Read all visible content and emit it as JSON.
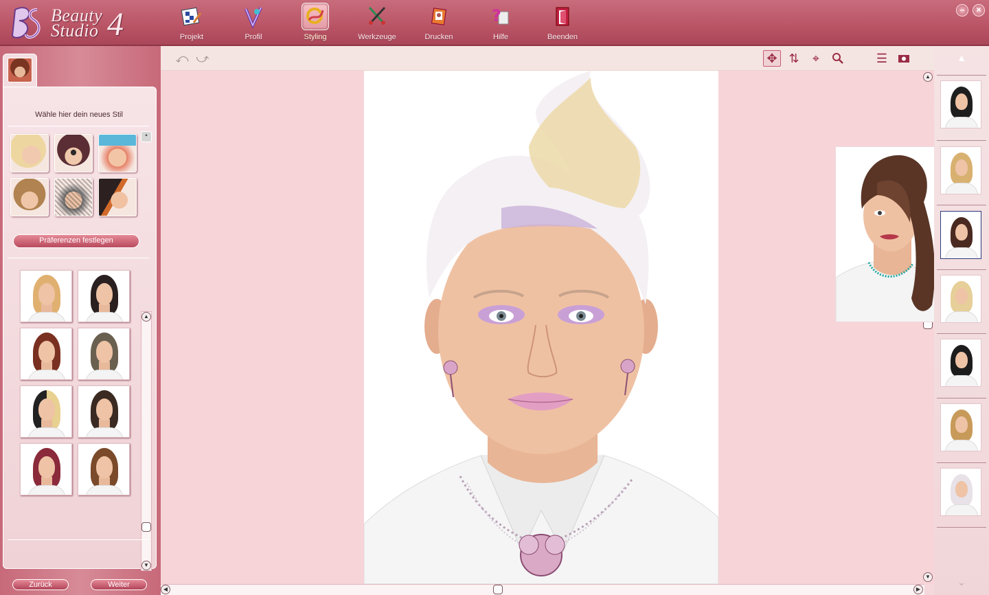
{
  "app": {
    "logo_line1": "Beauty",
    "logo_line2": "Studio",
    "logo_version": "4"
  },
  "nav": [
    {
      "label": "Projekt",
      "icon": "project-icon"
    },
    {
      "label": "Profil",
      "icon": "profile-icon"
    },
    {
      "label": "Styling",
      "icon": "styling-icon",
      "active": true
    },
    {
      "label": "Werkzeuge",
      "icon": "tools-icon"
    },
    {
      "label": "Drucken",
      "icon": "print-icon"
    },
    {
      "label": "Hilfe",
      "icon": "help-icon"
    },
    {
      "label": "Beenden",
      "icon": "exit-icon"
    }
  ],
  "window": {
    "minimize": "–",
    "close": "×"
  },
  "left_panel": {
    "title": "Wähle hier dein neues Stil",
    "preferences_button": "Präferenzen festlegen",
    "back_button": "Zurück",
    "next_button": "Weiter"
  },
  "colors": {
    "accent": "#b94a5e",
    "header": "#b95465",
    "canvas_bg": "#f6d4d8",
    "selected_border": "#2a3a7a"
  }
}
